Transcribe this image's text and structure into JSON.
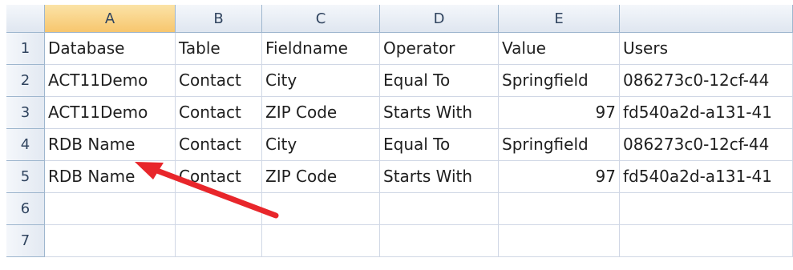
{
  "columns": [
    "A",
    "B",
    "C",
    "D",
    "E",
    ""
  ],
  "rows": [
    {
      "n": "1",
      "cells": [
        "Database",
        "Table",
        "Fieldname",
        "Operator",
        "Value",
        "Users"
      ]
    },
    {
      "n": "2",
      "cells": [
        "ACT11Demo",
        "Contact",
        "City",
        "Equal To",
        "Springfield",
        "086273c0-12cf-44"
      ]
    },
    {
      "n": "3",
      "cells": [
        "ACT11Demo",
        "Contact",
        "ZIP Code",
        "Starts With",
        "97",
        "fd540a2d-a131-41"
      ]
    },
    {
      "n": "4",
      "cells": [
        "RDB Name",
        "Contact",
        "City",
        "Equal To",
        "Springfield",
        "086273c0-12cf-44"
      ]
    },
    {
      "n": "5",
      "cells": [
        "RDB Name",
        "Contact",
        "ZIP Code",
        "Starts With",
        "97",
        "fd540a2d-a131-41"
      ]
    },
    {
      "n": "6",
      "cells": [
        "",
        "",
        "",
        "",
        "",
        ""
      ]
    },
    {
      "n": "7",
      "cells": [
        "",
        "",
        "",
        "",
        "",
        ""
      ]
    }
  ],
  "selected_column": "A",
  "annotation": {
    "arrow_color": "#e8262b",
    "points_to": "RDB Name"
  }
}
